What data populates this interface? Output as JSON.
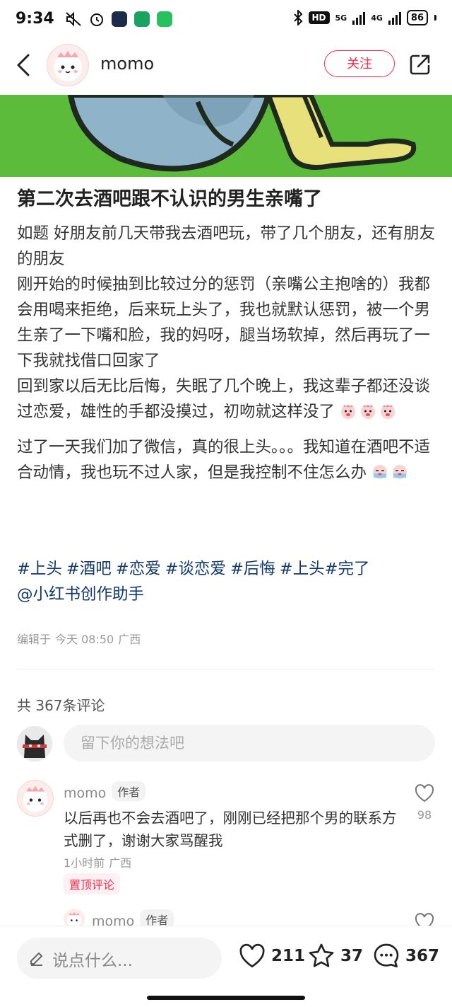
{
  "status_bar": {
    "time": "9:34",
    "network_1": "5G",
    "network_2": "4G",
    "hd_label": "HD",
    "battery": "86"
  },
  "header": {
    "author": "momo",
    "follow_label": "关注"
  },
  "post": {
    "title": "第二次去酒吧跟不认识的男生亲嘴了",
    "paragraphs": [
      "如题 好朋友前几天带我去酒吧玩，带了几个朋友，还有朋友的朋友",
      "刚开始的时候抽到比较过分的惩罚（亲嘴公主抱啥的）我都会用喝来拒绝，后来玩上头了，我也就默认惩罚，被一个男生亲了一下嘴和脸，我的妈呀，腿当场软掉，然后再玩了一下我就找借口回家了",
      "回到家以后无比后悔，失眠了几个晚上，我这辈子都还没谈过恋爱，雄性的手都没摸过，初吻就这样没了",
      "过了一天我们加了微信，真的很上头。。。我知道在酒吧不适合动情，我也玩不过人家，但是我控制不住怎么办"
    ],
    "tags": [
      "#上头",
      "#酒吧",
      "#恋爱",
      "#谈恋爱",
      "#后悔",
      "#上头",
      "#完了"
    ],
    "mention": "@小红书创作助手",
    "edited_label": "编辑于",
    "edited_time": "今天 08:50",
    "location": "广西"
  },
  "comments_section": {
    "count_label": "共 367条评论",
    "input_placeholder": "留下你的想法吧"
  },
  "comments": [
    {
      "author": "momo",
      "author_tag": "作者",
      "text": "以后再也不会去酒吧了，刚刚已经把那个男的联系方式删了，谢谢大家骂醒我",
      "time": "1小时前",
      "location": "广西",
      "pin_label": "置顶评论",
      "likes": "98"
    },
    {
      "author": "momo",
      "author_tag": "作者"
    }
  ],
  "bottom_bar": {
    "say_placeholder": "说点什么...",
    "likes": "211",
    "stars": "37",
    "comments": "367"
  },
  "colors": {
    "accent": "#ff2a4a",
    "tag_blue": "#13386c",
    "image_green": "#5dbb3b"
  }
}
